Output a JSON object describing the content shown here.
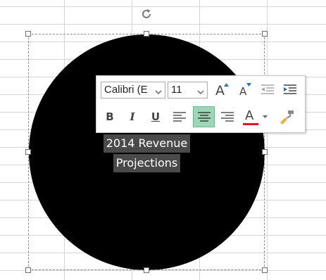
{
  "shape": {
    "text_line1": "2014 Revenue",
    "text_line2": "Projections",
    "fill_color": "#000000",
    "text_color": "#ffffff"
  },
  "mini_toolbar": {
    "font_name": "Calibri (E",
    "font_size": "11",
    "buttons": [
      {
        "name": "grow-font",
        "icon": "grow-font-icon"
      },
      {
        "name": "shrink-font",
        "icon": "shrink-font-icon"
      },
      {
        "name": "decrease-indent",
        "icon": "decrease-indent-icon"
      },
      {
        "name": "increase-indent",
        "icon": "increase-indent-icon"
      },
      {
        "name": "bold",
        "label": "B"
      },
      {
        "name": "italic",
        "label": "I"
      },
      {
        "name": "underline",
        "label": "U"
      },
      {
        "name": "align-left",
        "icon": "align-left-icon"
      },
      {
        "name": "align-center",
        "icon": "align-center-icon",
        "active": true
      },
      {
        "name": "align-right",
        "icon": "align-right-icon"
      },
      {
        "name": "font-color",
        "icon": "font-color-icon",
        "underline_color": "#e81123"
      },
      {
        "name": "format-painter",
        "icon": "format-painter-icon"
      }
    ],
    "grow_font_glyph": "A",
    "shrink_font_glyph": "A",
    "bold_label": "B",
    "italic_label": "I",
    "underline_label": "U",
    "font_color_glyph": "A",
    "accent_color": "#9fd5b7",
    "font_color_bar": "#e81123"
  }
}
